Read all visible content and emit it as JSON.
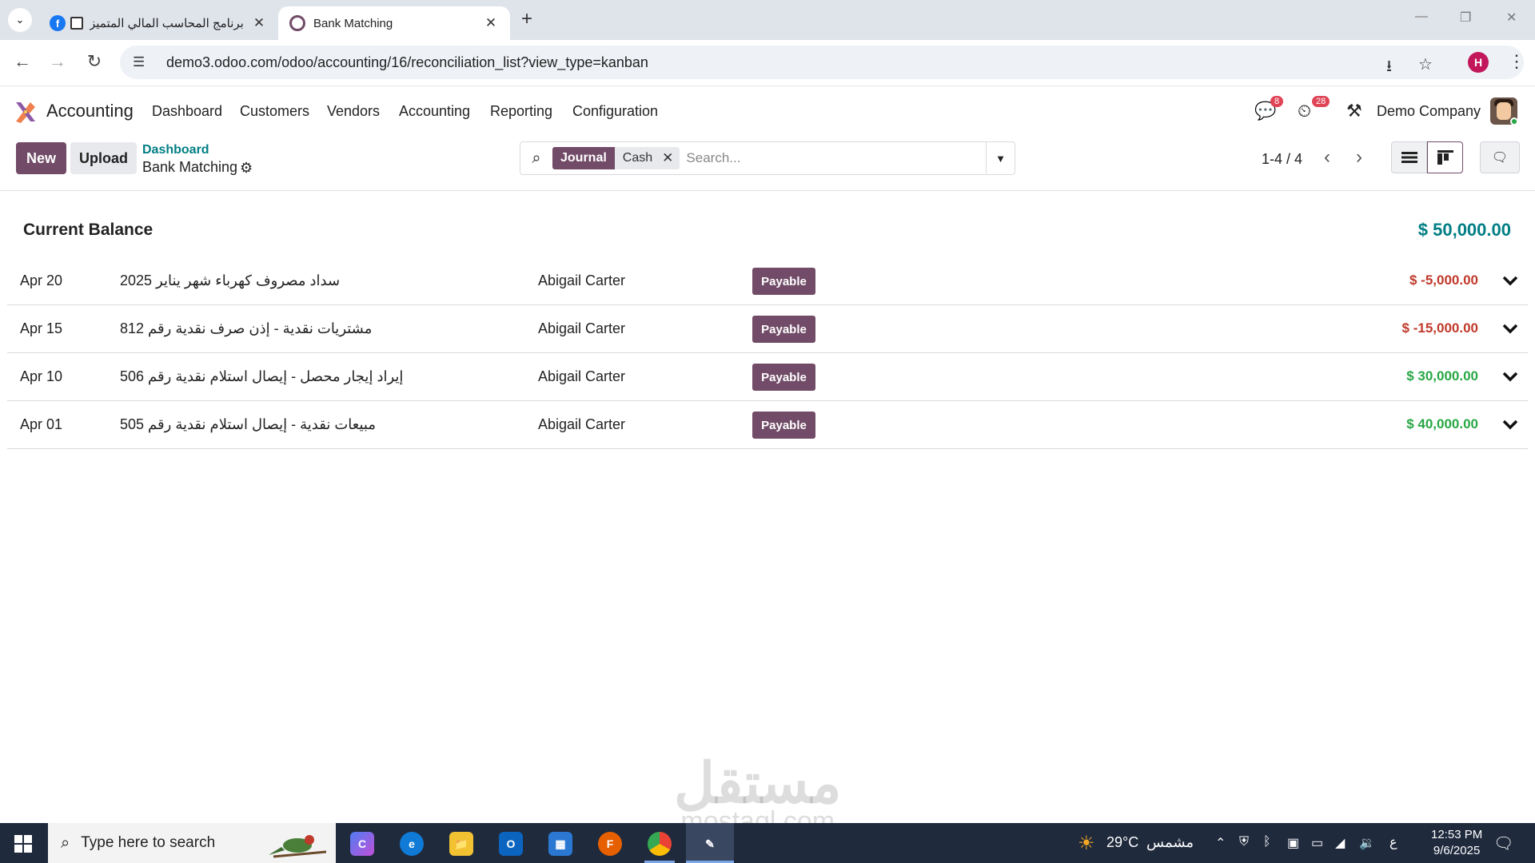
{
  "browser": {
    "tabs": [
      {
        "title": "برنامج المحاسب المالي المتميز",
        "active": false
      },
      {
        "title": "Bank Matching",
        "active": true
      }
    ],
    "url": "demo3.odoo.com/odoo/accounting/16/reconciliation_list?view_type=kanban",
    "profile_initial": "H"
  },
  "navbar": {
    "app_name": "Accounting",
    "menus": [
      "Dashboard",
      "Customers",
      "Vendors",
      "Accounting",
      "Reporting",
      "Configuration"
    ],
    "messages_count": "8",
    "activities_count": "28",
    "company": "Demo Company"
  },
  "control_panel": {
    "new_label": "New",
    "upload_label": "Upload",
    "breadcrumb_parent": "Dashboard",
    "breadcrumb_current": "Bank Matching",
    "facet_key": "Journal",
    "facet_value": "Cash",
    "search_placeholder": "Search...",
    "pager": "1-4 / 4"
  },
  "balance": {
    "label": "Current Balance",
    "value": "$ 50,000.00"
  },
  "lines": [
    {
      "date": "Apr 20",
      "label": "سداد مصروف كهرباء شهر يناير 2025",
      "partner": "Abigail Carter",
      "tag": "Payable",
      "amount": "$ -5,000.00",
      "sign": "neg"
    },
    {
      "date": "Apr 15",
      "label": "مشتريات نقدية - إذن صرف نقدية رقم 812",
      "partner": "Abigail Carter",
      "tag": "Payable",
      "amount": "$ -15,000.00",
      "sign": "neg"
    },
    {
      "date": "Apr 10",
      "label": "إيراد إيجار محصل - إيصال استلام نقدية رقم 506",
      "partner": "Abigail Carter",
      "tag": "Payable",
      "amount": "$ 30,000.00",
      "sign": "pos"
    },
    {
      "date": "Apr 01",
      "label": "مبيعات نقدية - إيصال استلام نقدية رقم 505",
      "partner": "Abigail Carter",
      "tag": "Payable",
      "amount": "$ 40,000.00",
      "sign": "pos"
    }
  ],
  "watermark": {
    "arabic": "مستقل",
    "latin": "mostaql.com"
  },
  "taskbar": {
    "search_placeholder": "Type here to search",
    "weather_temp": "29°C",
    "weather_label": "مشمس",
    "lang": "ع",
    "time": "12:53 PM",
    "date": "9/6/2025"
  },
  "colors": {
    "brand": "#714b67",
    "link": "#017e84",
    "negative": "#c0392b",
    "positive": "#28a745"
  }
}
